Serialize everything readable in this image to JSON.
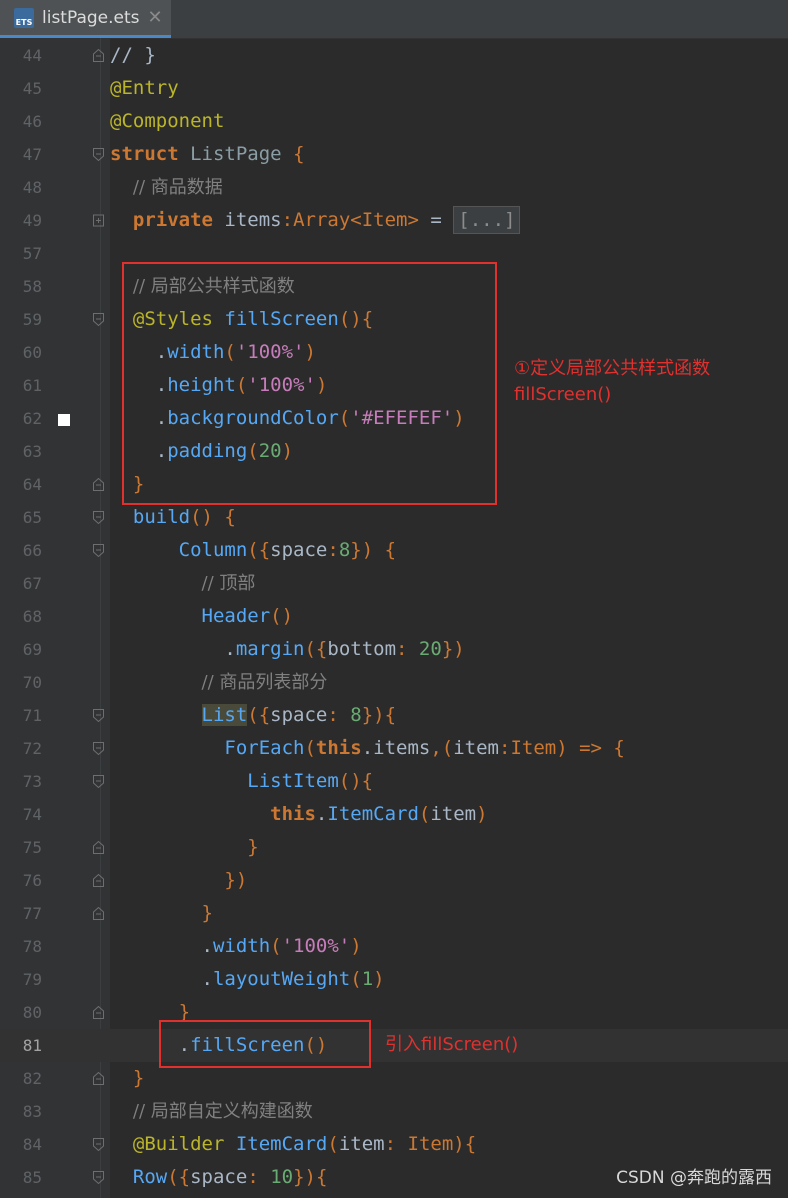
{
  "tab": {
    "file_name": "listPage.ets",
    "badge": "ETS"
  },
  "lines": [
    {
      "num": "44",
      "html": "// }"
    },
    {
      "num": "45",
      "html": "<span class='d'>@Entry</span>"
    },
    {
      "num": "46",
      "html": "<span class='d'>@Component</span>"
    },
    {
      "num": "47",
      "html": "<span class='k'>struct</span> <span style='color:#8a9ea5'>ListPage</span> <span class='p'>{</span>"
    },
    {
      "num": "48",
      "html": "  <span class='c'>// 商品数据</span>"
    },
    {
      "num": "49",
      "html": "  <span class='k'>private</span> items<span class='p'>:</span><span class='ty'>Array</span><span class='p'>&lt;</span><span class='ty'>Item</span><span class='p'>&gt;</span> = <span class='fold-collapsed'>[...]</span>"
    },
    {
      "num": "57",
      "html": ""
    },
    {
      "num": "58",
      "html": "  <span class='c'>// 局部公共样式函数</span>"
    },
    {
      "num": "59",
      "html": "  <span class='d'>@Styles</span> <span class='fn'>fillScreen</span><span class='p'>(){</span>"
    },
    {
      "num": "60",
      "html": "    .<span class='fn'>width</span><span class='p'>(</span><span class='s'>'100%'</span><span class='p'>)</span>"
    },
    {
      "num": "61",
      "html": "    .<span class='fn'>height</span><span class='p'>(</span><span class='s'>'100%'</span><span class='p'>)</span>"
    },
    {
      "num": "62",
      "html": "    .<span class='fn'>backgroundColor</span><span class='p'>(</span><span class='s'>'#EFEFEF'</span><span class='p'>)</span>"
    },
    {
      "num": "63",
      "html": "    .<span class='fn'>padding</span><span class='p'>(</span><span class='n'>20</span><span class='p'>)</span>"
    },
    {
      "num": "64",
      "html": "  <span class='p'>}</span>"
    },
    {
      "num": "65",
      "html": "  <span class='fn'>build</span><span class='p'>() {</span>"
    },
    {
      "num": "66",
      "html": "      <span class='fn'>Column</span><span class='p'>({</span>space<span class='p'>:</span><span class='n'>8</span><span class='p'>}) {</span>"
    },
    {
      "num": "67",
      "html": "        <span class='c'>// 顶部</span>"
    },
    {
      "num": "68",
      "html": "        <span class='fn'>Header</span><span class='p'>()</span>"
    },
    {
      "num": "69",
      "html": "          .<span class='fn'>margin</span><span class='p'>({</span>bottom<span class='p'>:</span> <span class='n'>20</span><span class='p'>})</span>"
    },
    {
      "num": "70",
      "html": "        <span class='c'>// 商品列表部分</span>"
    },
    {
      "num": "71",
      "html": "        <span class='fn list-hl'>List</span><span class='p'>({</span>space<span class='p'>:</span> <span class='n'>8</span><span class='p'>}){</span>"
    },
    {
      "num": "72",
      "html": "          <span class='fn'>ForEach</span><span class='p'>(</span><span class='k'>this</span>.items<span class='p'>,(</span>item<span class='p'>:</span><span class='ty'>Item</span><span class='p'>) =&gt; {</span>"
    },
    {
      "num": "73",
      "html": "            <span class='fn'>ListItem</span><span class='p'>(){</span>"
    },
    {
      "num": "74",
      "html": "              <span class='k'>this</span>.<span class='fn'>ItemCard</span><span class='p'>(</span>item<span class='p'>)</span>"
    },
    {
      "num": "75",
      "html": "            <span class='p'>}</span>"
    },
    {
      "num": "76",
      "html": "          <span class='p'>})</span>"
    },
    {
      "num": "77",
      "html": "        <span class='p'>}</span>"
    },
    {
      "num": "78",
      "html": "        .<span class='fn'>width</span><span class='p'>(</span><span class='s'>'100%'</span><span class='p'>)</span>"
    },
    {
      "num": "79",
      "html": "        .<span class='fn'>layoutWeight</span><span class='p'>(</span><span class='n'>1</span><span class='p'>)</span>"
    },
    {
      "num": "80",
      "html": "      <span class='p'>}</span>"
    },
    {
      "num": "81",
      "html": "      .<span class='fn'>fillScreen</span><span class='p'>()</span>"
    },
    {
      "num": "82",
      "html": "  <span class='p'>}</span>"
    },
    {
      "num": "83",
      "html": "  <span class='c'>// 局部自定义构建函数</span>"
    },
    {
      "num": "84",
      "html": "  <span class='d'>@Builder</span> <span class='fn'>ItemCard</span><span class='p'>(</span>item<span class='p'>:</span> <span class='ty'>Item</span><span class='p'>){</span>"
    },
    {
      "num": "85",
      "html": "  <span class='fn'>Row</span><span class='p'>({</span>space<span class='p'>:</span> <span class='n'>10</span><span class='p'>}){</span>"
    }
  ],
  "annotations": {
    "define_line1": "①定义局部公共样式函数",
    "define_line2": "fillScreen()",
    "use": "引入fillScreen()"
  },
  "watermark": "CSDN @奔跑的露西",
  "colors": {
    "highlight_box": "#e0312f",
    "editor_bg": "#2b2b2b"
  }
}
